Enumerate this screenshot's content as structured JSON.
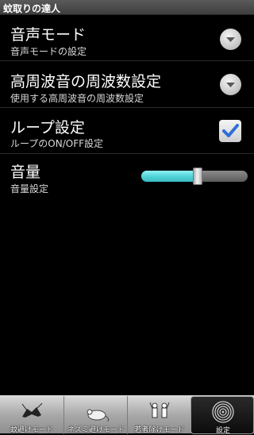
{
  "app": {
    "title": "蚊取りの達人"
  },
  "settings": {
    "voice_mode": {
      "title": "音声モード",
      "summary": "音声モードの設定"
    },
    "frequency": {
      "title": "高周波音の周波数設定",
      "summary": "使用する高周波音の周波数設定"
    },
    "loop": {
      "title": "ループ設定",
      "summary": "ループのON/OFF設定",
      "checked": true
    },
    "volume": {
      "title": "音量",
      "summary": "音量設定",
      "level": 0.53
    }
  },
  "tabs": [
    {
      "label": "蚊避けモード",
      "icon": "mosquito-icon",
      "active": false
    },
    {
      "label": "ネズミ避けモード",
      "icon": "mouse-icon",
      "active": false
    },
    {
      "label": "若者除けモード",
      "icon": "youth-icon",
      "active": false
    },
    {
      "label": "設定",
      "icon": "settings-spiral-icon",
      "active": true
    }
  ],
  "colors": {
    "accent": "#4ed1d6",
    "check": "#2f6fd6"
  }
}
